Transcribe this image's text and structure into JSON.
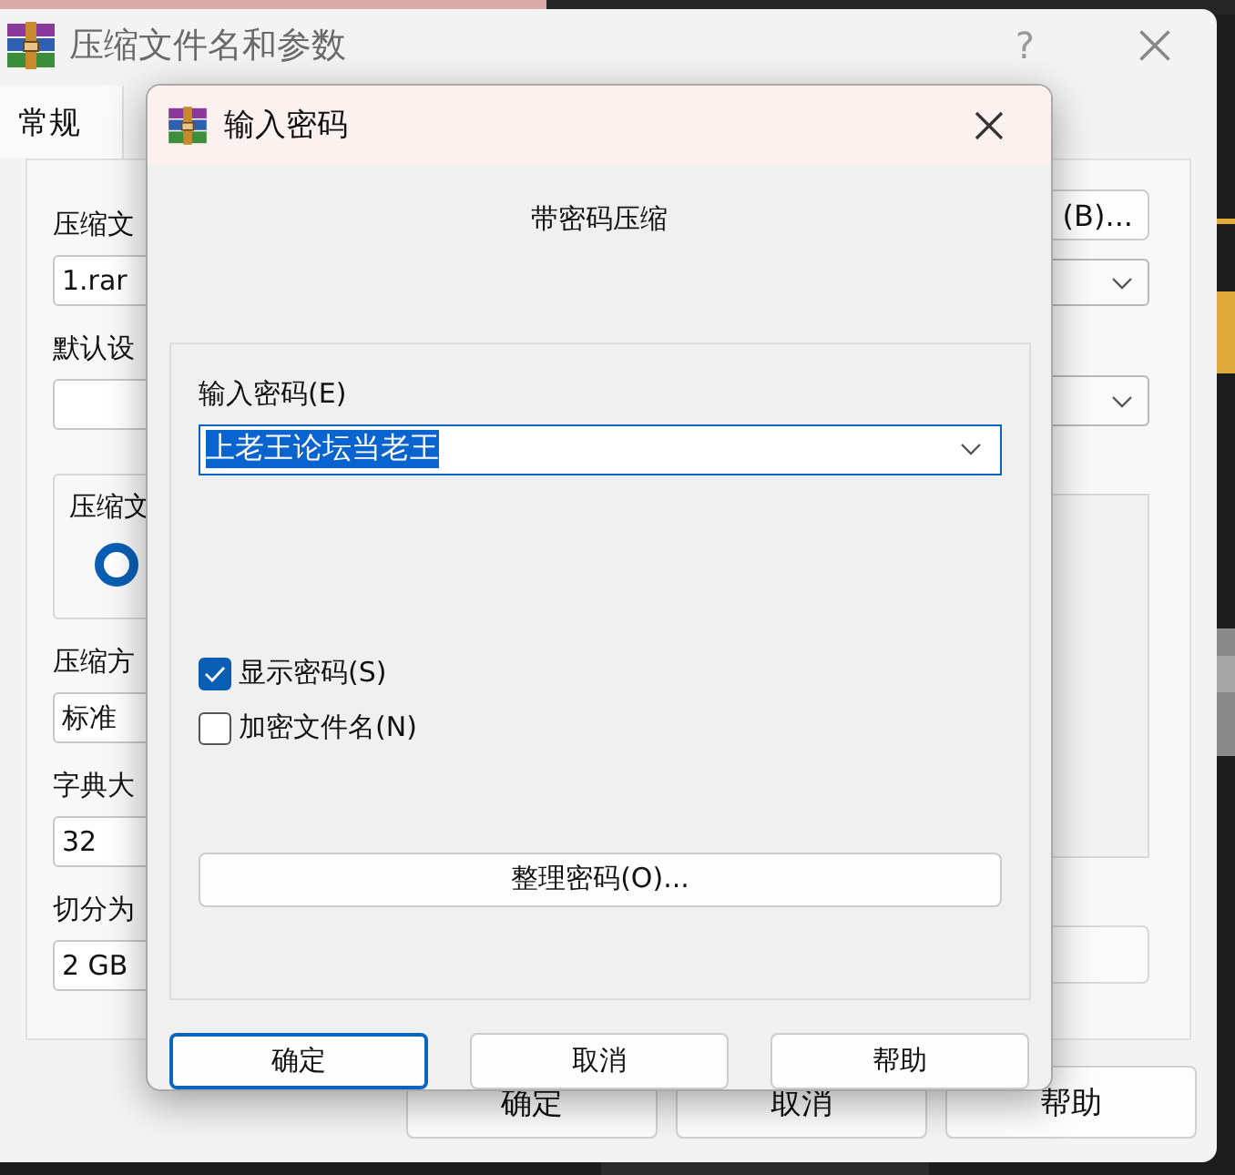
{
  "main_window": {
    "title": "压缩文件名和参数",
    "help_glyph": "?",
    "tabs": [
      {
        "label": "常规",
        "selected": true
      }
    ],
    "browse_button": "(B)...",
    "archive_name": {
      "label": "压缩文",
      "value": "1.rar"
    },
    "profile": {
      "label": "默认设"
    },
    "format_group": {
      "label": "压缩文",
      "radio_selected": true
    },
    "method": {
      "label": "压缩方",
      "value": "标准"
    },
    "dictionary": {
      "label": "字典大",
      "value": "32"
    },
    "split": {
      "label": "切分为",
      "value": "2 GB"
    },
    "buttons": [
      {
        "label": "确定"
      },
      {
        "label": "取消"
      },
      {
        "label": "帮助"
      }
    ]
  },
  "password_dialog": {
    "title": "输入密码",
    "heading": "带密码压缩",
    "password": {
      "label": "输入密码(E)",
      "value": "上老王论坛当老王",
      "selected": true
    },
    "options": [
      {
        "label": "显示密码(S)",
        "checked": true
      },
      {
        "label": "加密文件名(N)",
        "checked": false
      }
    ],
    "organize_button": "整理密码(O)...",
    "buttons": [
      {
        "label": "确定",
        "default": true
      },
      {
        "label": "取消",
        "default": false
      },
      {
        "label": "帮助",
        "default": false
      }
    ]
  }
}
